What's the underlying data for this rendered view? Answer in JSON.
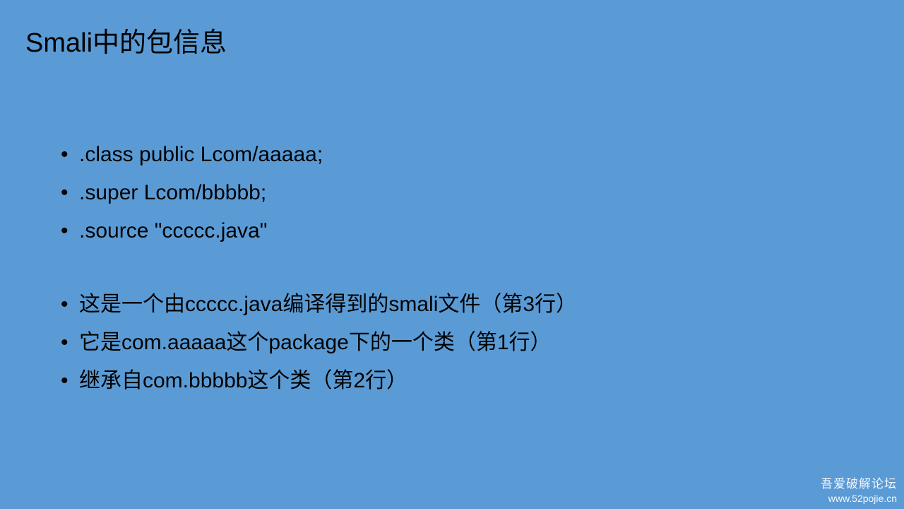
{
  "slide": {
    "title": "Smali中的包信息",
    "bullets_group1": [
      ".class public Lcom/aaaaa;",
      ".super Lcom/bbbbb;",
      ".source \"ccccc.java\""
    ],
    "bullets_group2": [
      "这是一个由ccccc.java编译得到的smali文件（第3行）",
      "它是com.aaaaa这个package下的一个类（第1行）",
      "继承自com.bbbbb这个类（第2行）"
    ],
    "bullet_symbol": "•"
  },
  "watermark": {
    "name": "吾爱破解论坛",
    "url": "www.52pojie.cn"
  },
  "colors": {
    "background": "#5b9bd5",
    "text": "#000000",
    "watermark": "#ffffff"
  }
}
